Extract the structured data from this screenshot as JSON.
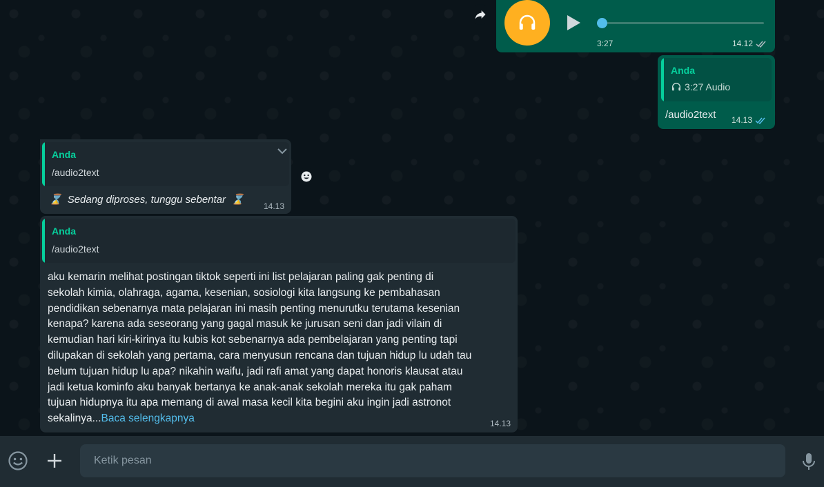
{
  "audio_message": {
    "duration": "3:27",
    "time": "14.12",
    "progress": 0,
    "avatar_color": "#ffb020",
    "avatar_icon": "headphones-icon"
  },
  "reply_message": {
    "quote_author": "Anda",
    "quote_text": "3:27 Audio",
    "text": "/audio2text",
    "time": "14.13"
  },
  "processing_message": {
    "quote_author": "Anda",
    "quote_text": "/audio2text",
    "text": "Sedang diproses, tunggu sebentar",
    "time": "14.13",
    "emoji": "⌛"
  },
  "transcript_message": {
    "quote_author": "Anda",
    "quote_text": "/audio2text",
    "text": "aku kemarin melihat postingan tiktok seperti ini list pelajaran paling gak penting di\nsekolah kimia, olahraga, agama, kesenian, sosiologi kita langsung ke pembahasan\npendidikan sebenarnya mata pelajaran ini masih penting menurutku terutama kesenian\nkenapa? karena ada seseorang yang gagal masuk ke jurusan seni dan jadi vilain di\nkemudian hari kiri-kirinya itu kubis kot sebenarnya ada pembelajaran yang penting tapi\ndilupakan di sekolah yang pertama, cara menyusun rencana dan tujuan hidup lu udah tau\nbelum tujuan hidup lu apa? nikahin waifu, jadi rafi amat yang dapat honoris klausat atau\njadi ketua kominfo aku banyak bertanya ke anak-anak sekolah mereka itu gak paham\ntujuan hidupnya itu apa memang di awal masa kecil kita begini aku ingin jadi astronot\nsekalinya...",
    "read_more": "Baca selengkapnya",
    "time": "14.13"
  },
  "composer": {
    "placeholder": "Ketik pesan"
  },
  "colors": {
    "outgoing_bubble": "#005c4b",
    "incoming_bubble": "#202c33",
    "accent": "#06cf9c",
    "read_ticks": "#53bdeb"
  }
}
